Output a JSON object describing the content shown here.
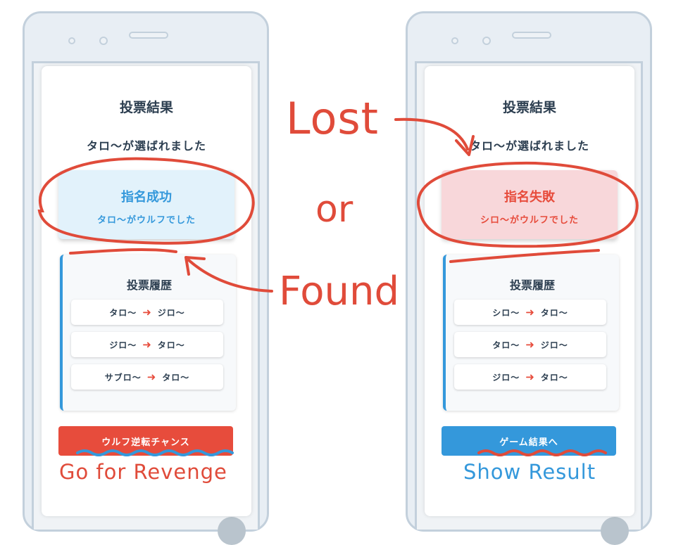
{
  "left": {
    "title": "投票結果",
    "subtitle": "タロ〜が選ばれました",
    "result_title": "指名成功",
    "result_subtitle": "タロ〜がウルフでした",
    "history_title": "投票履歴",
    "votes": [
      {
        "from": "タロ〜",
        "to": "ジロ〜"
      },
      {
        "from": "ジロ〜",
        "to": "タロ〜"
      },
      {
        "from": "サブロ〜",
        "to": "タロ〜"
      }
    ],
    "button_label": "ウルフ逆転チャンス"
  },
  "right": {
    "title": "投票結果",
    "subtitle": "タロ〜が選ばれました",
    "result_title": "指名失敗",
    "result_subtitle": "シロ〜がウルフでした",
    "history_title": "投票履歴",
    "votes": [
      {
        "from": "シロ〜",
        "to": "タロ〜"
      },
      {
        "from": "タロ〜",
        "to": "ジロ〜"
      },
      {
        "from": "ジロ〜",
        "to": "タロ〜"
      }
    ],
    "button_label": "ゲーム結果へ"
  },
  "annotations": {
    "lost": "Lost",
    "or": "or",
    "found": "Found",
    "revenge": "Go for Revenge",
    "show_result": "Show Result"
  },
  "colors": {
    "accent_blue": "#3498db",
    "accent_red": "#e74c3c",
    "annotation_red": "#e04b3a"
  },
  "arrow_glyph": "➜"
}
